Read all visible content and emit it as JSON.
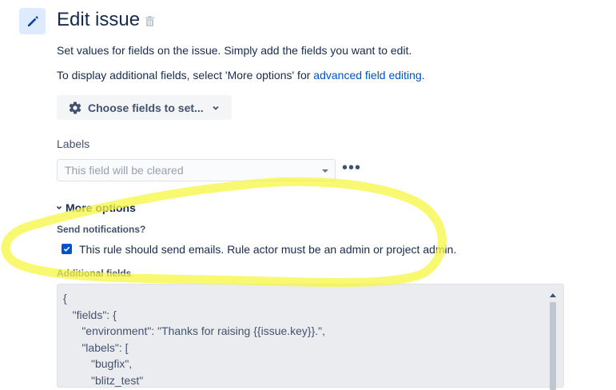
{
  "header": {
    "title": "Edit issue",
    "icon": "pencil-icon",
    "delete_icon": "trash-icon"
  },
  "intro": {
    "line1": "Set values for fields on the issue. Simply add the fields you want to edit.",
    "line2_prefix": "To display additional fields, select 'More options' for ",
    "line2_link": "advanced field editing",
    "line2_suffix": "."
  },
  "choose_fields": {
    "label": "Choose fields to set..."
  },
  "labels_field": {
    "label": "Labels",
    "placeholder": "This field will be cleared",
    "more_actions": "•••"
  },
  "more_options": {
    "toggle_label": "More options",
    "send_notifications_label": "Send notifications?",
    "send_emails_checked": true,
    "send_emails_text": "This rule should send emails. Rule actor must be an admin or project admin.",
    "additional_fields_label": "Additional fields",
    "additional_fields_value": "{\n   \"fields\": {\n      \"environment\": \"Thanks for raising {{issue.key}}.\",\n      \"labels\": [\n         \"bugfix\",\n         \"blitz_test\""
  },
  "colors": {
    "accent": "#0052cc",
    "highlight": "#f5f542",
    "icon_bg": "#deebff"
  }
}
